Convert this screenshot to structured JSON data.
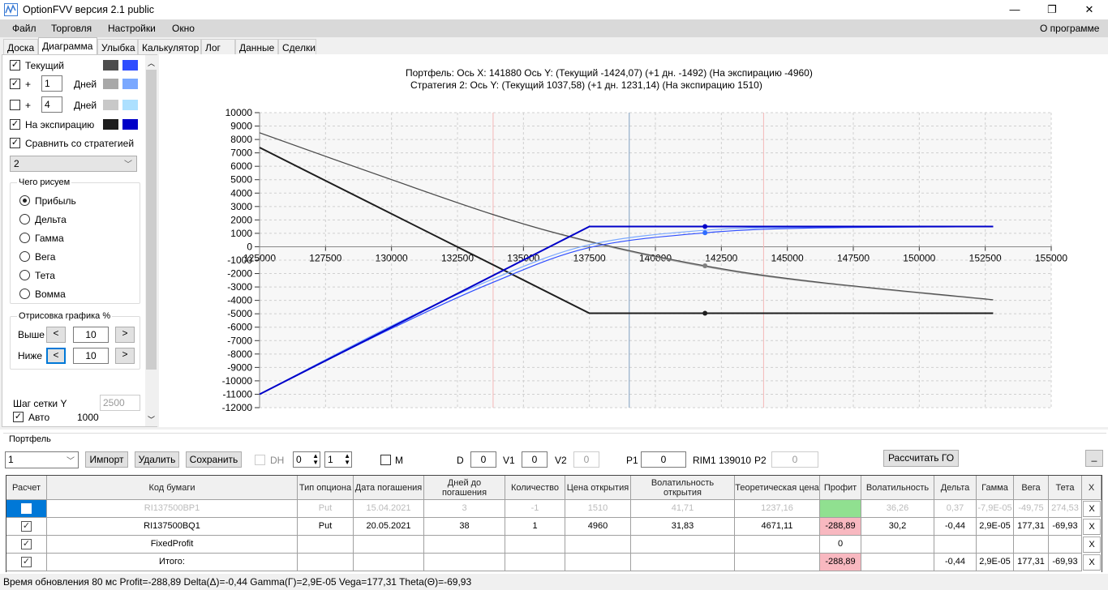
{
  "window": {
    "title": "OptionFVV версия 2.1 public",
    "minimize": "—",
    "maximize": "❐",
    "close": "✕"
  },
  "menu": [
    "Файл",
    "Торговля",
    "Настройки",
    "Окно"
  ],
  "menu_right": "О программе",
  "tabs": [
    "Доска",
    "Диаграмма",
    "Улыбка",
    "Калькулятор",
    "Лог",
    "Данные",
    "Сделки"
  ],
  "active_tab": "Диаграмма",
  "left": {
    "current": {
      "label": "Текущий",
      "checked": true,
      "colors": [
        "#4d4d4d",
        "#2e4dff"
      ]
    },
    "plus1": {
      "plus": "+",
      "days": "1",
      "unit": "Дней",
      "checked": true,
      "colors": [
        "#a8a8a8",
        "#7aa8ff"
      ]
    },
    "plus4": {
      "plus": "+",
      "days": "4",
      "unit": "Дней",
      "checked": false,
      "colors": [
        "#c8c8c8",
        "#ade0ff"
      ]
    },
    "expiry": {
      "label": "На экспирацию",
      "checked": true,
      "colors": [
        "#1e1e1e",
        "#0000c8"
      ]
    },
    "compare": {
      "label": "Сравнить со стратегией",
      "checked": true
    },
    "strategy_select": "2",
    "draw_group": {
      "title": "Чего рисуем",
      "options": [
        "Прибыль",
        "Дельта",
        "Гамма",
        "Вега",
        "Тета",
        "Вомма"
      ],
      "selected": "Прибыль"
    },
    "render_group": {
      "title": "Отрисовка графика %",
      "above_label": "Выше",
      "above_value": "10",
      "below_label": "Ниже",
      "below_value": "10",
      "dec": "<",
      "inc": ">"
    },
    "grid_step_label": "Шаг сетки Y",
    "grid_step_value": "2500",
    "auto_label": "Авто",
    "auto_checked": true,
    "auto_value": "1000"
  },
  "chart_header": {
    "line1": "Портфель: Ось X: 141880 Ось Y:  (Текущий -1424,07)  (+1 дн. -1492)  (На экспирацию -4960)",
    "line2": "Стратегия 2:  Ось Y:  (Текущий 1037,58)  (+1 дн. 1231,14)  (На экспирацию 1510)"
  },
  "chart_data": {
    "type": "line",
    "xlim": [
      125000,
      155000
    ],
    "ylim": [
      -12000,
      10000
    ],
    "xticks": [
      "125000",
      "127500",
      "130000",
      "132500",
      "135000",
      "137500",
      "140000",
      "142500",
      "145000",
      "147500",
      "150000",
      "152500",
      "155000"
    ],
    "yticks": [
      "10000",
      "9000",
      "8000",
      "7000",
      "6000",
      "5000",
      "4000",
      "3000",
      "2000",
      "1000",
      "0",
      "-1000",
      "-2000",
      "-3000",
      "-4000",
      "-5000",
      "-6000",
      "-7000",
      "-8000",
      "-9000",
      "-10000",
      "-11000",
      "-12000"
    ],
    "grid": true,
    "vlines": [
      {
        "x": 133850,
        "color": "#f4b8b8"
      },
      {
        "x": 139010,
        "color": "#7f9fc0"
      },
      {
        "x": 144100,
        "color": "#f4b8b8"
      }
    ],
    "cursor_x": 141880,
    "series": [
      {
        "color": "#a8a8a8",
        "width": 1.2,
        "smooth": true,
        "points": [
          [
            125000,
            8500
          ],
          [
            129000,
            5700
          ],
          [
            133850,
            2400
          ],
          [
            137500,
            350
          ],
          [
            141880,
            -1492
          ],
          [
            146000,
            -2650
          ],
          [
            152800,
            -3980
          ]
        ]
      },
      {
        "color": "#4d4d4d",
        "width": 1.2,
        "smooth": true,
        "points": [
          [
            125000,
            8500
          ],
          [
            129000,
            5700
          ],
          [
            133850,
            2400
          ],
          [
            137500,
            400
          ],
          [
            141880,
            -1424
          ],
          [
            146000,
            -2600
          ],
          [
            152800,
            -3950
          ]
        ]
      },
      {
        "color": "#1e1e1e",
        "width": 2,
        "smooth": false,
        "points": [
          [
            125000,
            7400
          ],
          [
            137500,
            -4960
          ],
          [
            152800,
            -4960
          ]
        ]
      },
      {
        "color": "#7aa8ff",
        "width": 1.2,
        "smooth": true,
        "points": [
          [
            125000,
            -11000
          ],
          [
            130000,
            -5900
          ],
          [
            133850,
            -2400
          ],
          [
            137500,
            150
          ],
          [
            141880,
            1231
          ],
          [
            146000,
            1460
          ],
          [
            152800,
            1510
          ]
        ]
      },
      {
        "color": "#2e4dff",
        "width": 1.2,
        "smooth": true,
        "points": [
          [
            125000,
            -11000
          ],
          [
            130000,
            -6100
          ],
          [
            133850,
            -2650
          ],
          [
            137500,
            -60
          ],
          [
            141880,
            1037
          ],
          [
            146000,
            1400
          ],
          [
            152800,
            1500
          ]
        ]
      },
      {
        "color": "#0000c8",
        "width": 2,
        "smooth": false,
        "points": [
          [
            125000,
            -11000
          ],
          [
            137500,
            1510
          ],
          [
            152800,
            1510
          ]
        ]
      }
    ],
    "markers": [
      {
        "x": 141880,
        "y": -1424,
        "color": "#808080"
      },
      {
        "x": 141880,
        "y": -4960,
        "color": "#1e1e1e"
      },
      {
        "x": 141880,
        "y": 1037,
        "color": "#2e6dff"
      },
      {
        "x": 141880,
        "y": 1510,
        "color": "#0000c8"
      }
    ]
  },
  "portfolio": {
    "title": "Портфель",
    "select": "1",
    "import": "Импорт",
    "delete": "Удалить",
    "save": "Сохранить",
    "dh": "DH",
    "spin1": "0",
    "spin2": "1",
    "m": "M",
    "d_label": "D",
    "d": "0",
    "v1_label": "V1",
    "v1": "0",
    "v2_label": "V2",
    "v2": "0",
    "p1_label": "P1",
    "p1": "0",
    "rim": "RIM1 139010",
    "p2_label": "P2",
    "p2": "0",
    "calc_go": "Рассчитать ГО",
    "min_btn": "_",
    "columns": [
      "Расчет",
      "Код бумаги",
      "Тип опциона",
      "Дата погашения",
      "Дней до погашения",
      "Количество",
      "Цена открытия",
      "Волатильность открытия",
      "Теоретическая цена",
      "Профит",
      "Волатильность",
      "Дельта",
      "Гамма",
      "Вега",
      "Тета",
      "X"
    ],
    "rows": [
      {
        "checked": false,
        "dim": true,
        "selected": true,
        "cells": [
          "RI137500BP1",
          "Put",
          "15.04.2021",
          "3",
          "-1",
          "1510",
          "41,71",
          "1237,16",
          "",
          "36,26",
          "0,37",
          "-7,9E-05",
          "-49,75",
          "274,53"
        ],
        "profit_color": "#90e090"
      },
      {
        "checked": true,
        "dim": false,
        "cells": [
          "RI137500BQ1",
          "Put",
          "20.05.2021",
          "38",
          "1",
          "4960",
          "31,83",
          "4671,11",
          "-288,89",
          "30,2",
          "-0,44",
          "2,9E-05",
          "177,31",
          "-69,93"
        ],
        "profit_color": "#f8b8c0"
      },
      {
        "checked": true,
        "dim": false,
        "cells": [
          "FixedProfit",
          "",
          "",
          "",
          "",
          "",
          "",
          "",
          "0",
          "",
          "",
          "",
          "",
          ""
        ],
        "profit_color": "#ffffff"
      },
      {
        "checked": true,
        "dim": false,
        "cells": [
          "Итого:",
          "",
          "",
          "",
          "",
          "",
          "",
          "",
          "-288,89",
          "",
          "-0,44",
          "2,9E-05",
          "177,31",
          "-69,93"
        ],
        "profit_color": "#f8b8c0"
      }
    ],
    "remove": "X"
  },
  "status": "Время обновления 80 мс  Profit=-288,89 Delta(Δ)=-0,44 Gamma(Γ)=2,9E-05 Vega=177,31 Theta(Θ)=-69,93"
}
